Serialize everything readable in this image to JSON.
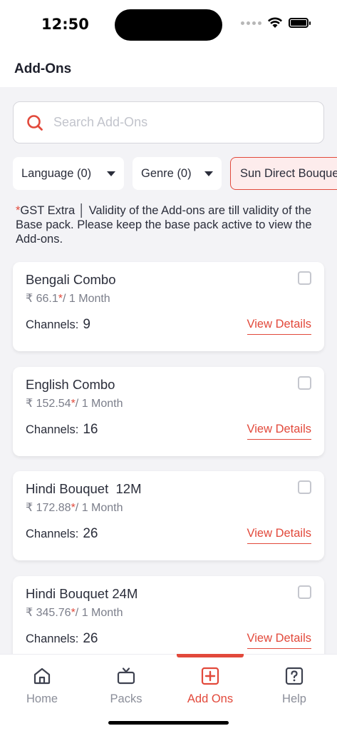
{
  "status": {
    "time": "12:50"
  },
  "header": {
    "title": "Add-Ons"
  },
  "search": {
    "placeholder": "Search Add-Ons",
    "value": ""
  },
  "filters": [
    {
      "label": "Language (0)"
    },
    {
      "label": "Genre (0)"
    },
    {
      "label": "Sun Direct Bouquet"
    }
  ],
  "note": {
    "star": "*",
    "text": "GST Extra │  Validity of the Add-ons are till validity of the Base pack. Please keep the base pack active to view the Add-ons."
  },
  "packs": [
    {
      "name": "Bengali Combo",
      "price": "₹ 66.1",
      "star": "*",
      "period": "/ 1 Month",
      "channels_label": "Channels:",
      "channels": "9",
      "link": "View Details"
    },
    {
      "name": "English Combo",
      "price": "₹ 152.54",
      "star": "*",
      "period": "/ 1 Month",
      "channels_label": "Channels:",
      "channels": "16",
      "link": "View Details"
    },
    {
      "name": "Hindi Bouquet  12M",
      "price": "₹ 172.88",
      "star": "*",
      "period": "/ 1 Month",
      "channels_label": "Channels:",
      "channels": "26",
      "link": "View Details"
    },
    {
      "name": "Hindi Bouquet 24M",
      "price": "₹ 345.76",
      "star": "*",
      "period": "/ 1 Month",
      "channels_label": "Channels:",
      "channels": "26",
      "link": "View Details"
    }
  ],
  "tabs": [
    {
      "label": "Home",
      "icon": "home-icon"
    },
    {
      "label": "Packs",
      "icon": "tv-icon"
    },
    {
      "label": "Add Ons",
      "icon": "plus-square-icon",
      "active": true
    },
    {
      "label": "Help",
      "icon": "help-icon"
    }
  ],
  "colors": {
    "accent": "#e2493b",
    "background": "#f3f3f6",
    "muted": "#8b8e99"
  }
}
